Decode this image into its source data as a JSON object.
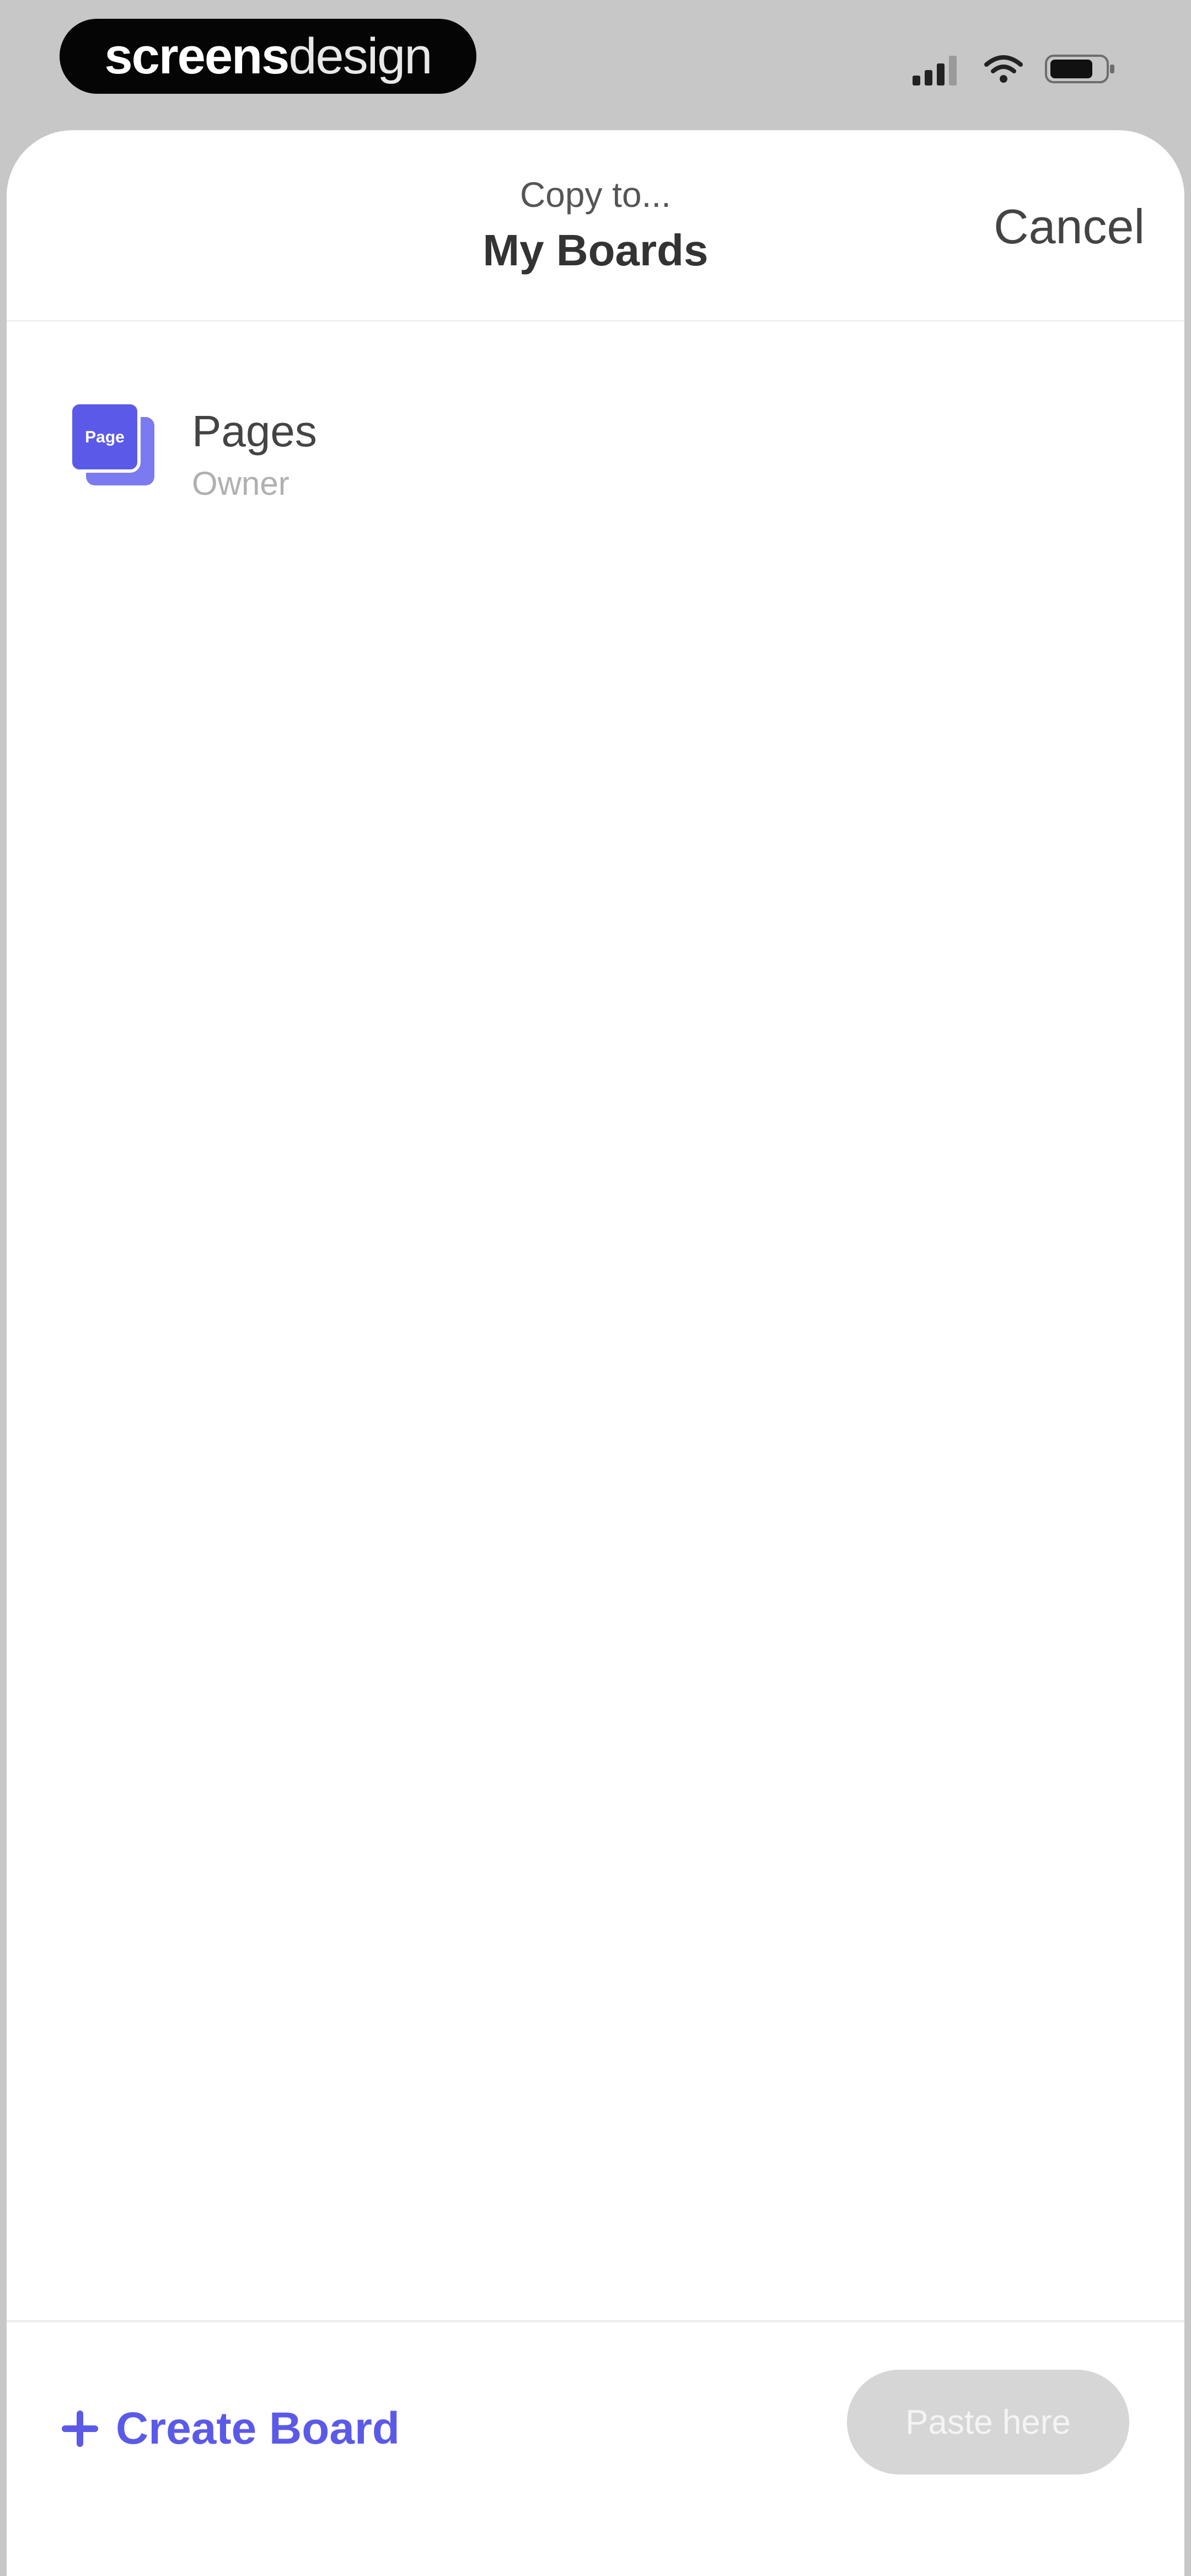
{
  "status_bar": {
    "brand_bold": "screens",
    "brand_light": "design",
    "icons": [
      "cellular-signal-icon",
      "wifi-icon",
      "battery-icon"
    ]
  },
  "sheet": {
    "subtitle": "Copy to...",
    "title": "My Boards",
    "cancel_label": "Cancel"
  },
  "boards": [
    {
      "name": "Pages",
      "role": "Owner",
      "icon": "board-stack-icon",
      "icon_text": "Page"
    }
  ],
  "footer": {
    "create_board_label": "Create Board",
    "create_icon": "plus-icon",
    "paste_label": "Paste here",
    "paste_enabled": false
  },
  "colors": {
    "accent": "#5b5ae8",
    "status_background": "#c7c7c7",
    "sheet_background": "#ffffff",
    "disabled_button": "#d6d6d6"
  }
}
